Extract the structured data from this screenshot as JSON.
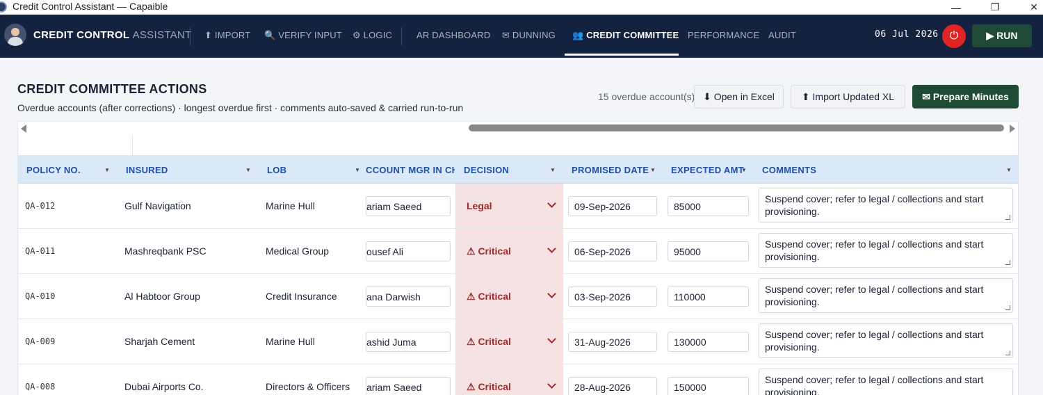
{
  "window": {
    "title": "Credit Control Assistant — Capaible",
    "minimize": "—",
    "maximize": "❐",
    "close": "✕"
  },
  "nav": {
    "brand_bold": "CREDIT CONTROL",
    "brand_light": "ASSISTANT",
    "items": [
      {
        "label": "⬆ IMPORT"
      },
      {
        "label": "🔍 VERIFY INPUT"
      },
      {
        "label": "⚙ LOGIC"
      },
      {
        "label": "AR DASHBOARD"
      },
      {
        "label": "✉ DUNNING"
      },
      {
        "label": "👥 CREDIT COMMITTEE"
      },
      {
        "label": "PERFORMANCE"
      },
      {
        "label": "AUDIT"
      }
    ],
    "active": "CREDIT COMMITTEE",
    "date": "06 Jul 2026",
    "power_icon": "⏻",
    "run_label": "▶ RUN"
  },
  "header": {
    "title": "CREDIT COMMITTEE ACTIONS",
    "subtitle": "Overdue accounts (after corrections) · longest overdue first · comments auto-saved & carried run-to-run",
    "overdue_count": "15 overdue account(s)",
    "open_excel": "⬇ Open in Excel",
    "import_xl": "⬆ Import Updated XL",
    "prepare_minutes": "✉ Prepare Minutes"
  },
  "table": {
    "columns": {
      "policy": "POLICY NO.",
      "insured": "INSURED",
      "lob": "LOB",
      "mgr": "CCOUNT MGR IN CH",
      "decision": "DECISION",
      "promised": "PROMISED DATE",
      "expected": "EXPECTED AMT",
      "comments": "COMMENTS"
    },
    "rows": [
      {
        "policy": "QA-012",
        "insured": "Gulf Navigation",
        "lob": "Marine Hull",
        "mgr": "ariam Saeed",
        "decision": "Legal",
        "promised": "09-Sep-2026",
        "expected": "85000",
        "comment": "Suspend cover; refer to legal / collections and start provisioning."
      },
      {
        "policy": "QA-011",
        "insured": "Mashreqbank PSC",
        "lob": "Medical Group",
        "mgr": "ousef Ali",
        "decision": "⚠ Critical",
        "promised": "06-Sep-2026",
        "expected": "95000",
        "comment": "Suspend cover; refer to legal / collections and start provisioning."
      },
      {
        "policy": "QA-010",
        "insured": "Al Habtoor Group",
        "lob": "Credit Insurance",
        "mgr": "ana Darwish",
        "decision": "⚠ Critical",
        "promised": "03-Sep-2026",
        "expected": "110000",
        "comment": "Suspend cover; refer to legal / collections and start provisioning."
      },
      {
        "policy": "QA-009",
        "insured": "Sharjah Cement",
        "lob": "Marine Hull",
        "mgr": "ashid Juma",
        "decision": "⚠ Critical",
        "promised": "31-Aug-2026",
        "expected": "130000",
        "comment": "Suspend cover; refer to legal / collections and start provisioning."
      },
      {
        "policy": "QA-008",
        "insured": "Dubai Airports Co.",
        "lob": "Directors & Officers",
        "mgr": "ariam Saeed",
        "decision": "⚠ Critical",
        "promised": "28-Aug-2026",
        "expected": "150000",
        "comment": "Suspend cover; refer to legal / collections and start provisioning."
      }
    ]
  },
  "colors": {
    "nav_bg": "#12223f",
    "accent_green": "#1f4a36",
    "header_blue": "#1f4fa8",
    "critical_red": "#a12a2a",
    "decision_bg": "#f6e2e2"
  }
}
